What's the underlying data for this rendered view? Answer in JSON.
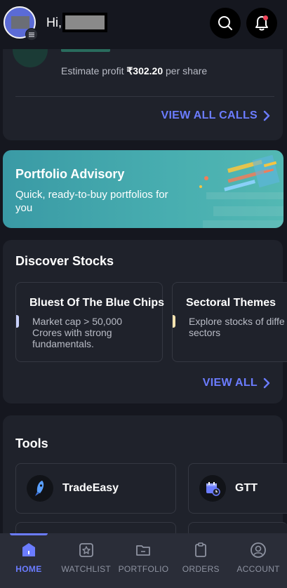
{
  "header": {
    "greeting": "Hi,"
  },
  "calls_card": {
    "estimate_profit_label": "Estimate profit",
    "estimate_profit_value": "₹302.20",
    "estimate_profit_suffix": "per share",
    "view_all_calls": "VIEW ALL CALLS"
  },
  "advisory": {
    "title": "Portfolio Advisory",
    "subtitle": "Quick, ready-to-buy portfolios for you"
  },
  "discover": {
    "title": "Discover Stocks",
    "cards": [
      {
        "title": "Bluest Of The Blue Chips",
        "desc": [
          "Market cap > 50,000",
          "Crores with strong",
          "fundamentals."
        ],
        "accent": "#c9d2ff"
      },
      {
        "title": "Sectoral Themes",
        "desc": [
          "Explore stocks of diffe",
          "sectors"
        ],
        "accent": "#f4e3b0"
      }
    ],
    "view_all": "VIEW ALL"
  },
  "tools": {
    "title": "Tools",
    "items": [
      {
        "label": "TradeEasy",
        "icon": "rocket-icon"
      },
      {
        "label": "GTT",
        "icon": "calendar-clock-icon"
      }
    ]
  },
  "nav": {
    "items": [
      {
        "label": "HOME",
        "icon": "home-icon",
        "active": true
      },
      {
        "label": "WATCHLIST",
        "icon": "star-icon",
        "active": false
      },
      {
        "label": "PORTFOLIO",
        "icon": "folder-icon",
        "active": false
      },
      {
        "label": "ORDERS",
        "icon": "clipboard-icon",
        "active": false
      },
      {
        "label": "ACCOUNT",
        "icon": "user-icon",
        "active": false
      }
    ]
  },
  "colors": {
    "background": "#15171f",
    "card": "#1f222b",
    "accent": "#6b7cff",
    "advisory": "#48aeb0",
    "notification": "#f0455a"
  }
}
